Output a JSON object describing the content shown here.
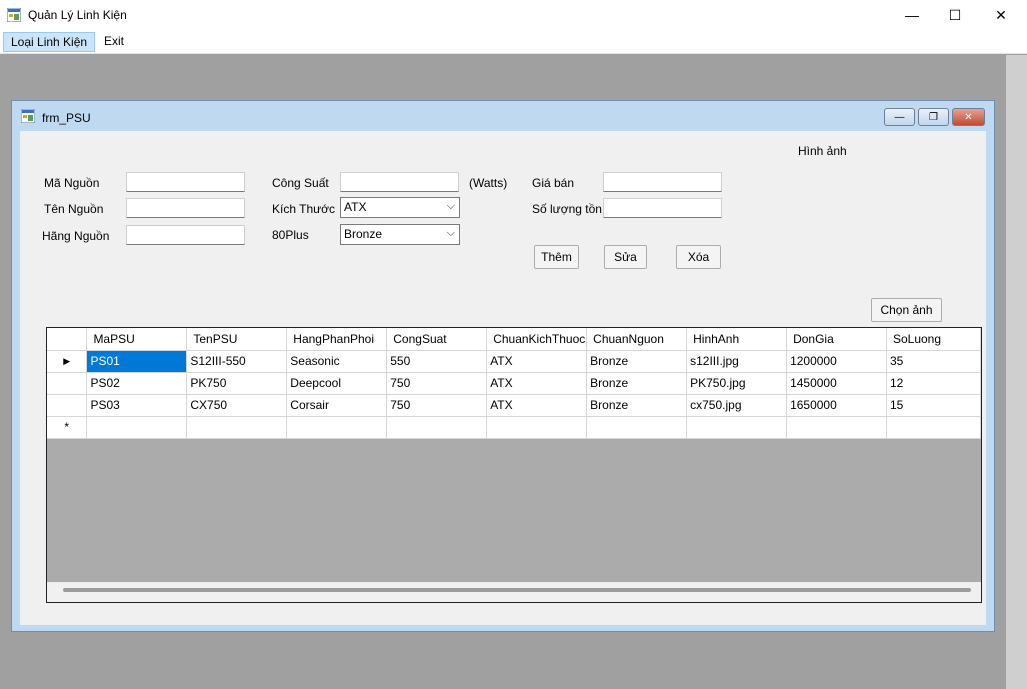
{
  "app": {
    "title": "Quản Lý Linh Kiện",
    "minimize": "—",
    "maximize": "☐",
    "close": "✕"
  },
  "menu": {
    "items": [
      {
        "label": "Loại Linh Kiện"
      },
      {
        "label": "Exit"
      }
    ]
  },
  "child_form": {
    "title": "frm_PSU",
    "minimize": "—",
    "restore": "❐",
    "close": "✕"
  },
  "form": {
    "ma_nguon_label": "Mã Nguồn",
    "ten_nguon_label": "Tên Nguồn",
    "hang_nguon_label": "Hãng Nguồn",
    "cong_suat_label": "Công Suất",
    "kich_thuoc_label": "Kích Thước",
    "plus80_label": "80Plus",
    "watts_label": "(Watts)",
    "gia_ban_label": "Giá bán",
    "so_luong_ton_label": "Số lượng tồn",
    "hinh_anh_label": "Hình ảnh",
    "ma_nguon_value": "",
    "ten_nguon_value": "",
    "hang_nguon_value": "",
    "cong_suat_value": "",
    "gia_ban_value": "",
    "so_luong_ton_value": "",
    "kich_thuoc_value": "ATX",
    "plus80_value": "Bronze",
    "them_button": "Thêm",
    "sua_button": "Sửa",
    "xoa_button": "Xóa",
    "chon_anh_button": "Chọn ảnh"
  },
  "grid": {
    "columns": [
      "MaPSU",
      "TenPSU",
      "HangPhanPhoi",
      "CongSuat",
      "ChuanKichThuoc",
      "ChuanNguon",
      "HinhAnh",
      "DonGia",
      "SoLuong"
    ],
    "rows": [
      [
        "PS01",
        "S12III-550",
        "Seasonic",
        "550",
        "ATX",
        "Bronze",
        "s12III.jpg",
        "1200000",
        "35"
      ],
      [
        "PS02",
        "PK750",
        "Deepcool",
        "750",
        "ATX",
        "Bronze",
        "PK750.jpg",
        "1450000",
        "12"
      ],
      [
        "PS03",
        "CX750",
        "Corsair",
        "750",
        "ATX",
        "Bronze",
        "cx750.jpg",
        "1650000",
        "15"
      ]
    ],
    "current_row_marker": "▶",
    "new_row_marker": "*"
  },
  "colors": {
    "selection": "#0078d7",
    "mdi_background": "#a0a0a0",
    "child_border": "#bfd9f0"
  }
}
